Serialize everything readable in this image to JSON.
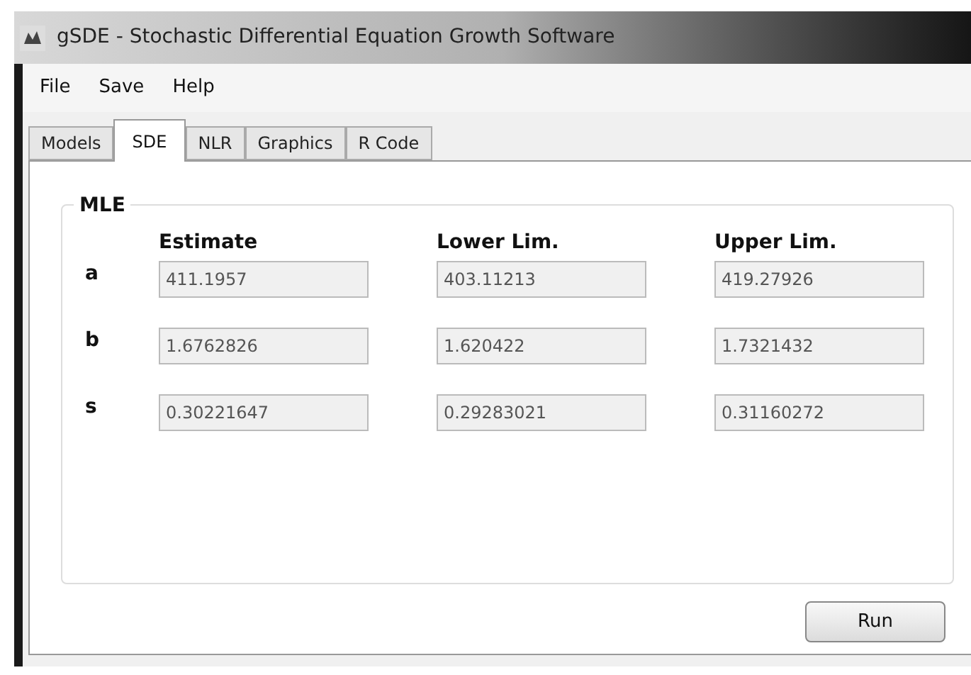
{
  "window": {
    "title": "gSDE - Stochastic Differential Equation Growth Software"
  },
  "menu": [
    "File",
    "Save",
    "Help"
  ],
  "tabs": [
    {
      "label": "Models",
      "selected": false
    },
    {
      "label": "SDE",
      "selected": true
    },
    {
      "label": "NLR",
      "selected": false
    },
    {
      "label": "Graphics",
      "selected": false
    },
    {
      "label": "R Code",
      "selected": false
    }
  ],
  "group": {
    "title": "MLE",
    "columns": [
      "Estimate",
      "Lower Lim.",
      "Upper Lim."
    ],
    "rows": [
      {
        "label": "a",
        "values": [
          "411.1957",
          "403.11213",
          "419.27926"
        ]
      },
      {
        "label": "b",
        "values": [
          "1.6762826",
          "1.620422",
          "1.7321432"
        ]
      },
      {
        "label": "s",
        "values": [
          "0.30221647",
          "0.29283021",
          "0.31160272"
        ]
      }
    ],
    "disabled": true
  },
  "button": "Run"
}
